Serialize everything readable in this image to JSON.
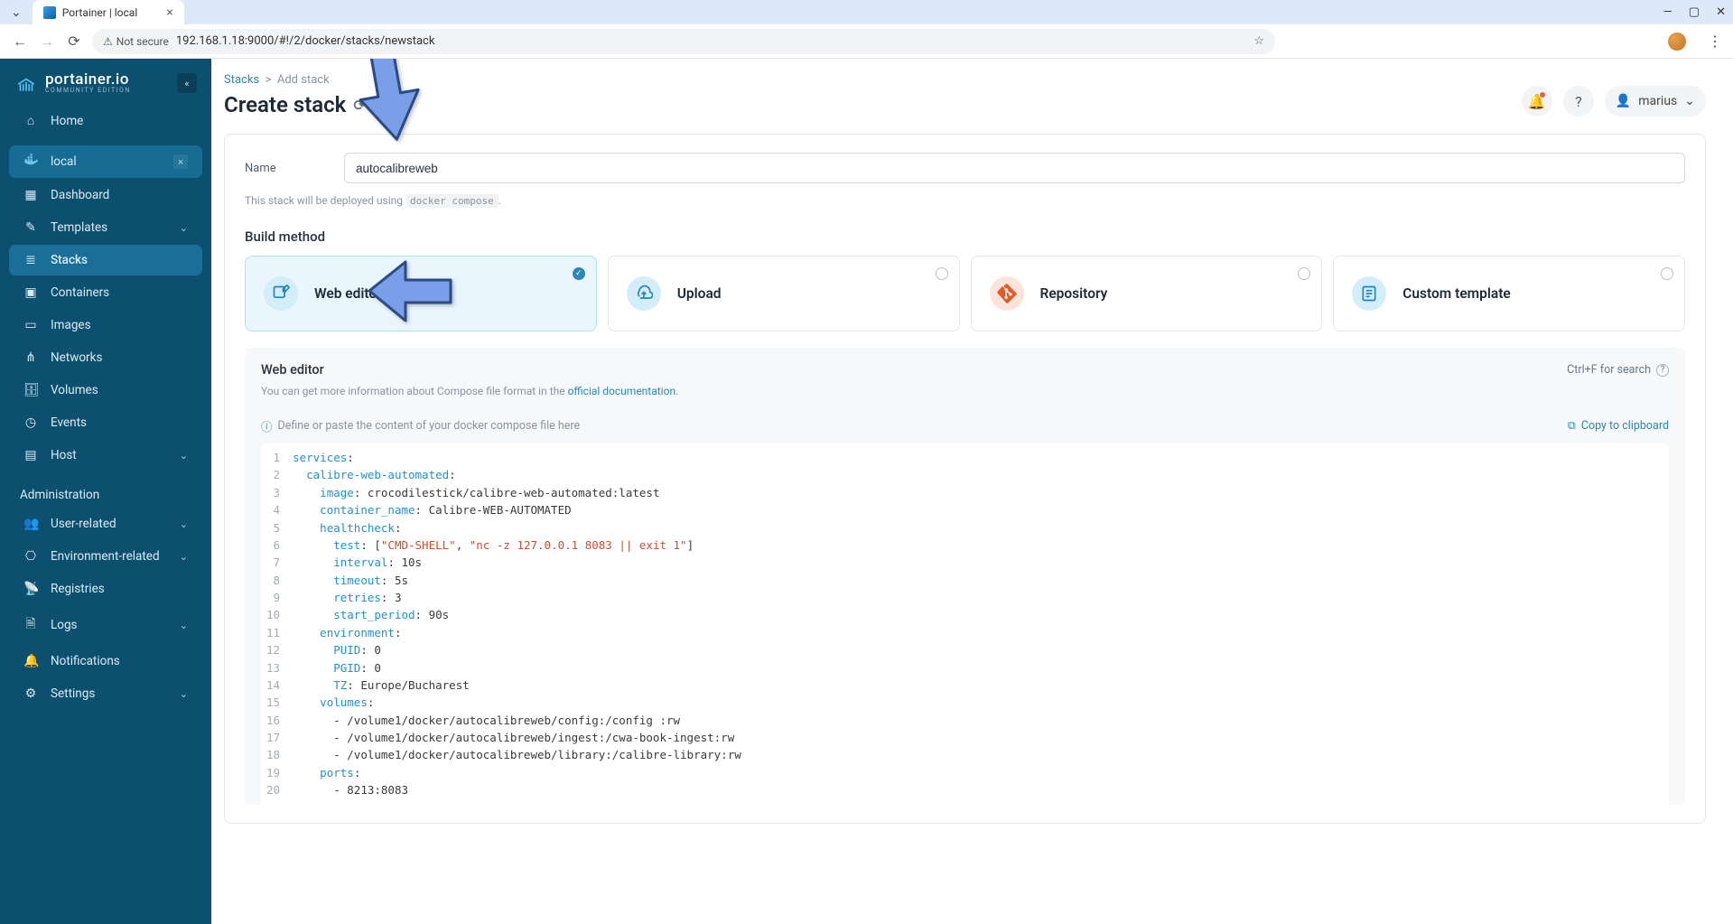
{
  "browser": {
    "tab_title": "Portainer | local",
    "not_secure": "Not secure",
    "url": "192.168.1.18:9000/#!/2/docker/stacks/newstack"
  },
  "logo": {
    "main": "portainer.io",
    "sub": "COMMUNITY EDITION"
  },
  "sidebar": {
    "home": "Home",
    "env": "local",
    "items": [
      "Dashboard",
      "Templates",
      "Stacks",
      "Containers",
      "Images",
      "Networks",
      "Volumes",
      "Events",
      "Host"
    ],
    "admin_heading": "Administration",
    "admin_items": [
      "User-related",
      "Environment-related",
      "Registries",
      "Logs",
      "Notifications",
      "Settings"
    ]
  },
  "breadcrumb": {
    "root": "Stacks",
    "sep": ">",
    "leaf": "Add stack"
  },
  "page_title": "Create stack",
  "form": {
    "name_label": "Name",
    "name_value": "autocalibreweb",
    "deploy_hint_prefix": "This stack will be deployed using ",
    "deploy_hint_code": "docker compose",
    "deploy_hint_suffix": "."
  },
  "build": {
    "heading": "Build method",
    "methods": [
      "Web editor",
      "Upload",
      "Repository",
      "Custom template"
    ]
  },
  "editor": {
    "title": "Web editor",
    "search_hint": "Ctrl+F for search",
    "doc_hint_prefix": "You can get more information about Compose file format in the ",
    "doc_hint_link": "official documentation",
    "doc_hint_suffix": ".",
    "define_hint": "Define or paste the content of your docker compose file here",
    "copy_label": "Copy to clipboard",
    "code_lines": [
      "services:",
      "  calibre-web-automated:",
      "    image: crocodilestick/calibre-web-automated:latest",
      "    container_name: Calibre-WEB-AUTOMATED",
      "    healthcheck:",
      "      test: [\"CMD-SHELL\", \"nc -z 127.0.0.1 8083 || exit 1\"]",
      "      interval: 10s",
      "      timeout: 5s",
      "      retries: 3",
      "      start_period: 90s",
      "    environment:",
      "      PUID: 0",
      "      PGID: 0",
      "      TZ: Europe/Bucharest",
      "    volumes:",
      "      - /volume1/docker/autocalibreweb/config:/config :rw",
      "      - /volume1/docker/autocalibreweb/ingest:/cwa-book-ingest:rw",
      "      - /volume1/docker/autocalibreweb/library:/calibre-library:rw",
      "    ports:",
      "      - 8213:8083"
    ]
  },
  "user": {
    "name": "marius"
  }
}
